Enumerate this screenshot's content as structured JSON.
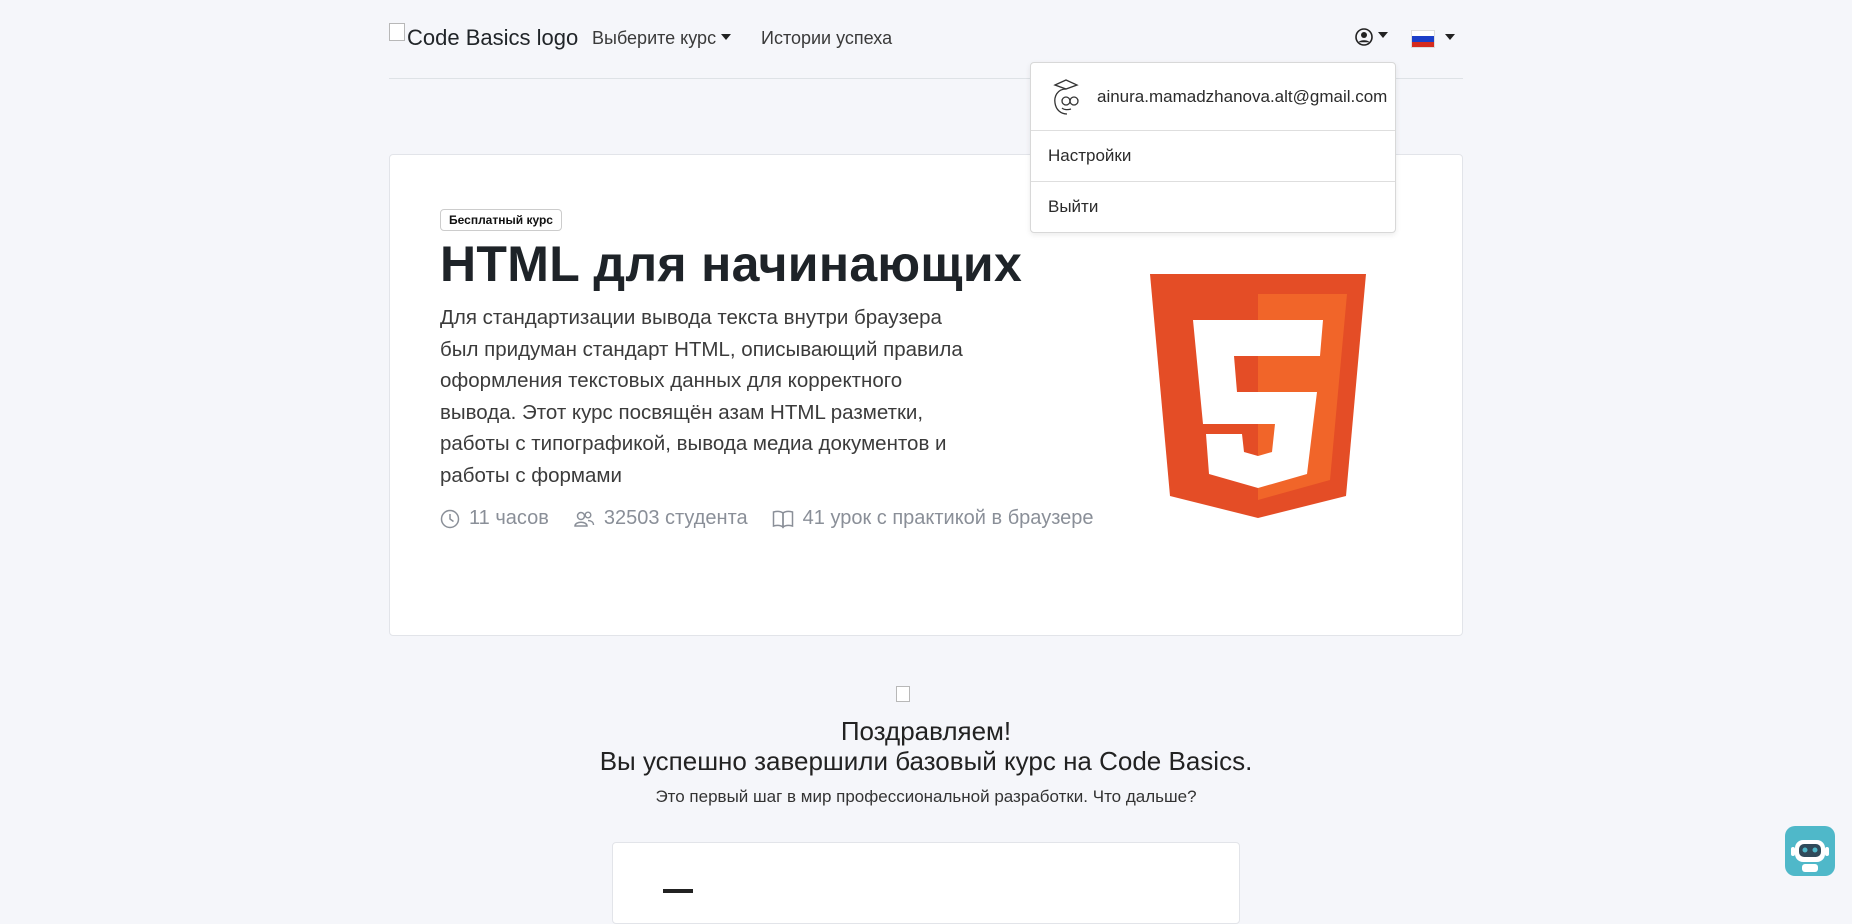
{
  "header": {
    "logo_alt": "Code Basics logo",
    "nav_course": "Выберите курс",
    "nav_stories": "Истории успеха"
  },
  "user_menu": {
    "email": "ainura.mamadzhanova.alt@gmail.com",
    "settings": "Настройки",
    "logout": "Выйти"
  },
  "course": {
    "badge": "Бесплатный курс",
    "title": "HTML для начинающих",
    "description": "Для стандартизации вывода текста внутри браузера был придуман стандарт HTML, описывающий правила оформления текстовых данных для корректного вывода. Этот курс посвящён азам HTML разметки, работы с типографикой, вывода медиа документов и работы с формами",
    "duration": "11 часов",
    "students": "32503 студента",
    "lessons": "41 урок с практикой в браузере"
  },
  "congrats": {
    "title": "Поздравляем!",
    "subtitle": "Вы успешно завершили базовый курс на Code Basics.",
    "text": "Это первый шаг в мир профессиональной разработки. Что дальше?"
  },
  "colors": {
    "html5_orange": "#e44d26",
    "html5_light": "#f16529",
    "bot": "#4fb8c9"
  }
}
